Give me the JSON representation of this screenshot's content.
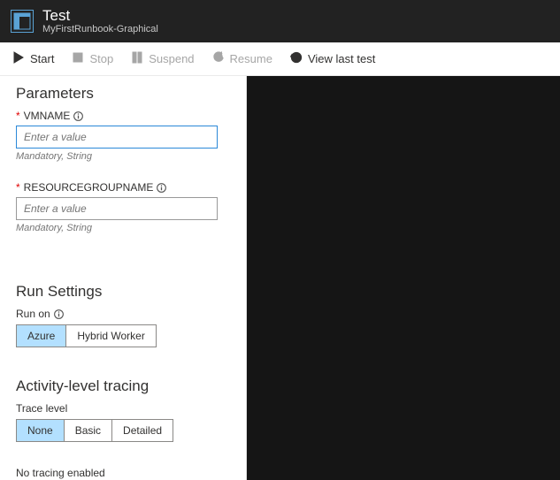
{
  "header": {
    "title": "Test",
    "subtitle": "MyFirstRunbook-Graphical"
  },
  "toolbar": {
    "start": "Start",
    "stop": "Stop",
    "suspend": "Suspend",
    "resume": "Resume",
    "viewLastTest": "View last test"
  },
  "parameters": {
    "heading": "Parameters",
    "vmname": {
      "label": "VMNAME",
      "placeholder": "Enter a value",
      "hint": "Mandatory, String"
    },
    "rgname": {
      "label": "RESOURCEGROUPNAME",
      "placeholder": "Enter a value",
      "hint": "Mandatory, String"
    }
  },
  "runSettings": {
    "heading": "Run Settings",
    "runOnLabel": "Run on",
    "options": {
      "azure": "Azure",
      "hybrid": "Hybrid Worker"
    }
  },
  "tracing": {
    "heading": "Activity-level tracing",
    "levelLabel": "Trace level",
    "options": {
      "none": "None",
      "basic": "Basic",
      "detailed": "Detailed"
    },
    "note": "No tracing enabled"
  }
}
